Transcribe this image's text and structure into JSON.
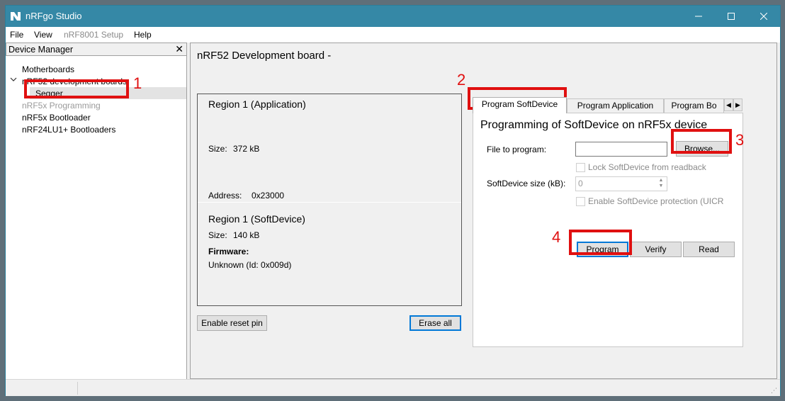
{
  "window": {
    "title": "nRFgo Studio",
    "controls": {
      "minimize": "minimize-icon",
      "maximize": "maximize-icon",
      "close": "close-icon"
    },
    "accent_color": "#3588a6"
  },
  "menu": {
    "items": [
      {
        "label": "File",
        "enabled": true
      },
      {
        "label": "View",
        "enabled": true
      },
      {
        "label": "nRF8001 Setup",
        "enabled": false
      },
      {
        "label": "Help",
        "enabled": true
      }
    ]
  },
  "device_manager": {
    "title": "Device Manager",
    "close_label": "✕",
    "tree": [
      {
        "label": "Motherboards",
        "enabled": true
      },
      {
        "label": "nRF52 development boards",
        "enabled": true,
        "expanded": true
      },
      {
        "label": "Segger",
        "enabled": true,
        "selected": true
      },
      {
        "label": "nRF5x Programming",
        "enabled": false
      },
      {
        "label": "nRF5x Bootloader",
        "enabled": true
      },
      {
        "label": "nRF24LU1+ Bootloaders",
        "enabled": true
      }
    ]
  },
  "main": {
    "board_title": "nRF52 Development board - ",
    "regions": {
      "app": {
        "title": "Region 1 (Application)",
        "size_label": "Size:",
        "size_value": "372 kB",
        "address_label": "Address:",
        "address_value": "0x23000"
      },
      "softdevice": {
        "title": "Region 1 (SoftDevice)",
        "size_label": "Size:",
        "size_value": "140 kB",
        "firmware_label": "Firmware:",
        "firmware_value": "Unknown (Id: 0x009d)"
      }
    },
    "enable_reset_pin": "Enable reset pin",
    "erase_all": "Erase all"
  },
  "tabs": {
    "items": [
      {
        "label": "Program SoftDevice",
        "active": true
      },
      {
        "label": "Program Application",
        "active": false
      },
      {
        "label": "Program Bo",
        "active": false
      }
    ],
    "scroll_left": "◀",
    "scroll_right": "▶"
  },
  "softdevice_page": {
    "title": "Programming of SoftDevice on nRF5x device",
    "file_label": "File to program:",
    "file_value": "",
    "browse": "Browse...",
    "lock_label": "Lock SoftDevice from readback",
    "lock_checked": false,
    "size_label": "SoftDevice size (kB):",
    "size_value": "0",
    "protect_label": "Enable SoftDevice protection (UICR",
    "protect_checked": false,
    "program": "Program",
    "verify": "Verify",
    "read": "Read"
  },
  "annotations": {
    "color": "#e01010",
    "labels": [
      "1",
      "2",
      "3",
      "4"
    ]
  }
}
